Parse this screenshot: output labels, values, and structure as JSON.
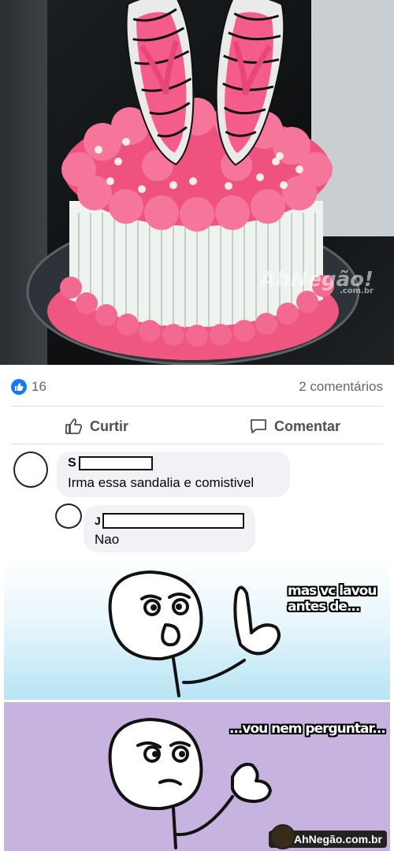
{
  "photo": {
    "subject": "cake with sandal toppers",
    "watermark_brand": "AhNegão!",
    "watermark_domain": ".com.br"
  },
  "post": {
    "like_count": "16",
    "comments_label": "2 comentários",
    "actions": {
      "like_label": "Curtir",
      "comment_label": "Comentar"
    }
  },
  "comments": [
    {
      "name_initial": "S",
      "text": "Irma essa sandalia e comistivel"
    },
    {
      "name_initial": "J",
      "text": "Nao"
    }
  ],
  "comic": {
    "panel1_text": "mas vc lavou antes de...",
    "panel2_text": "...vou nem perguntar...",
    "brand_label": "AhNegão.com.br"
  },
  "colors": {
    "facebook_blue": "#1877f2",
    "frosting_pink": "#f0527f",
    "comic_blue": "#b7e4f4",
    "comic_purple": "#c7b3df"
  }
}
